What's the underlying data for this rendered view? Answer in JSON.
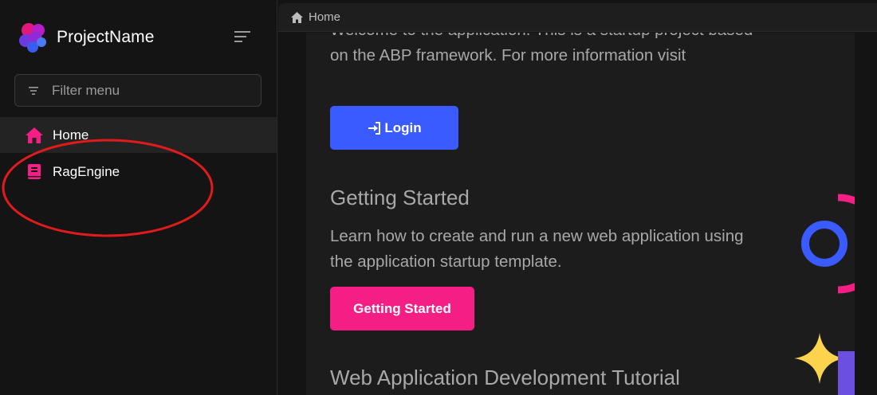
{
  "app": {
    "brand_name": "ProjectName",
    "accent_pink": "#f51e84",
    "accent_blue": "#3a5bff"
  },
  "sidebar": {
    "filter_placeholder": "Filter menu",
    "items": [
      {
        "label": "Home",
        "icon": "home-icon",
        "active": true
      },
      {
        "label": "RagEngine",
        "icon": "book-icon",
        "active": false
      }
    ]
  },
  "breadcrumb": {
    "icon": "home-icon",
    "label": "Home"
  },
  "main": {
    "intro_text": "Welcome to the application. This is a startup project based on the ABP framework. For more information visit",
    "login_label": "Login",
    "getting_started": {
      "title": "Getting Started",
      "text": "Learn how to create and run a new web application using the application startup template.",
      "button_label": "Getting Started"
    },
    "tutorial_title": "Web Application Development Tutorial"
  }
}
